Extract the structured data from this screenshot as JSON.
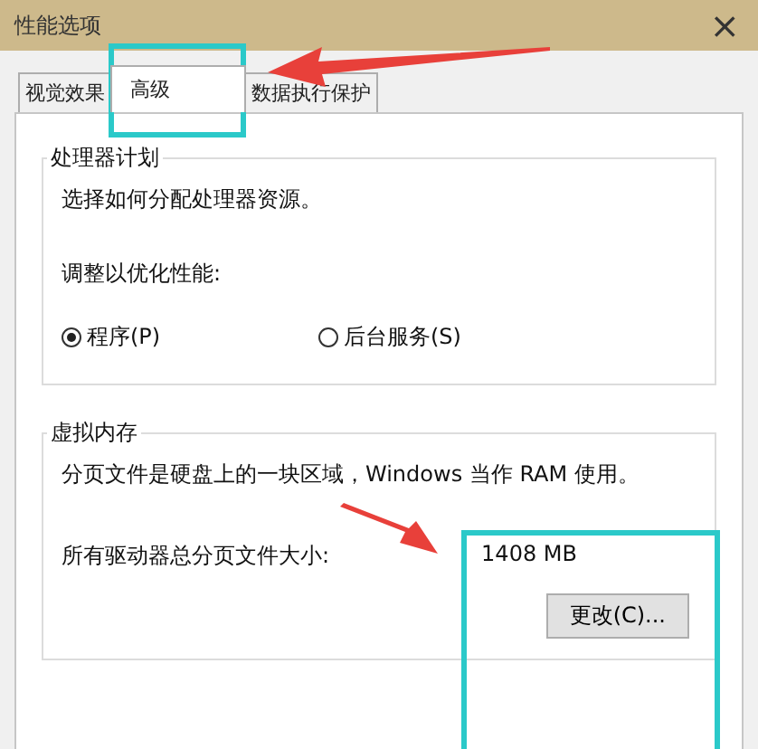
{
  "window": {
    "title": "性能选项",
    "close": "×"
  },
  "tabs": [
    {
      "label": "视觉效果",
      "selected": false
    },
    {
      "label": "高级",
      "selected": true
    },
    {
      "label": "数据执行保护",
      "selected": false
    }
  ],
  "processor_group": {
    "title": "处理器计划",
    "description": "选择如何分配处理器资源。",
    "prompt": "调整以优化性能:",
    "options": [
      {
        "label": "程序(P)",
        "selected": true
      },
      {
        "label": "后台服务(S)",
        "selected": false
      }
    ]
  },
  "memory_group": {
    "title": "虚拟内存",
    "description": "分页文件是硬盘上的一块区域，Windows 当作 RAM 使用。",
    "size_label": "所有驱动器总分页文件大小:",
    "size_value": "1408 MB",
    "button": "更改(C)..."
  }
}
